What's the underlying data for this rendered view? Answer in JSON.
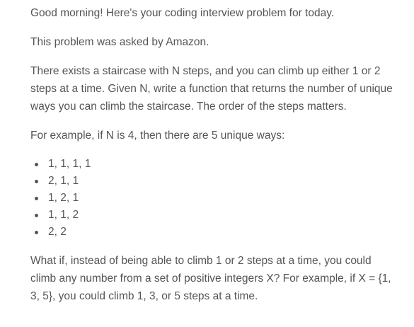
{
  "email": {
    "greeting": "Good morning! Here's your coding interview problem for today.",
    "source": "This problem was asked by Amazon.",
    "problem": "There exists a staircase with N steps, and you can climb up either 1 or 2 steps at a time. Given N, write a function that returns the number of unique ways you can climb the staircase. The order of the steps matters.",
    "example_intro": "For example, if N is 4, then there are 5 unique ways:",
    "ways": [
      "1, 1, 1, 1",
      "2, 1, 1",
      "1, 2, 1",
      "1, 1, 2",
      "2, 2"
    ],
    "followup": "What if, instead of being able to climb 1 or 2 steps at a time, you could climb any number from a set of positive integers X? For example, if X = {1, 3, 5}, you could climb 1, 3, or 5 steps at a time."
  }
}
